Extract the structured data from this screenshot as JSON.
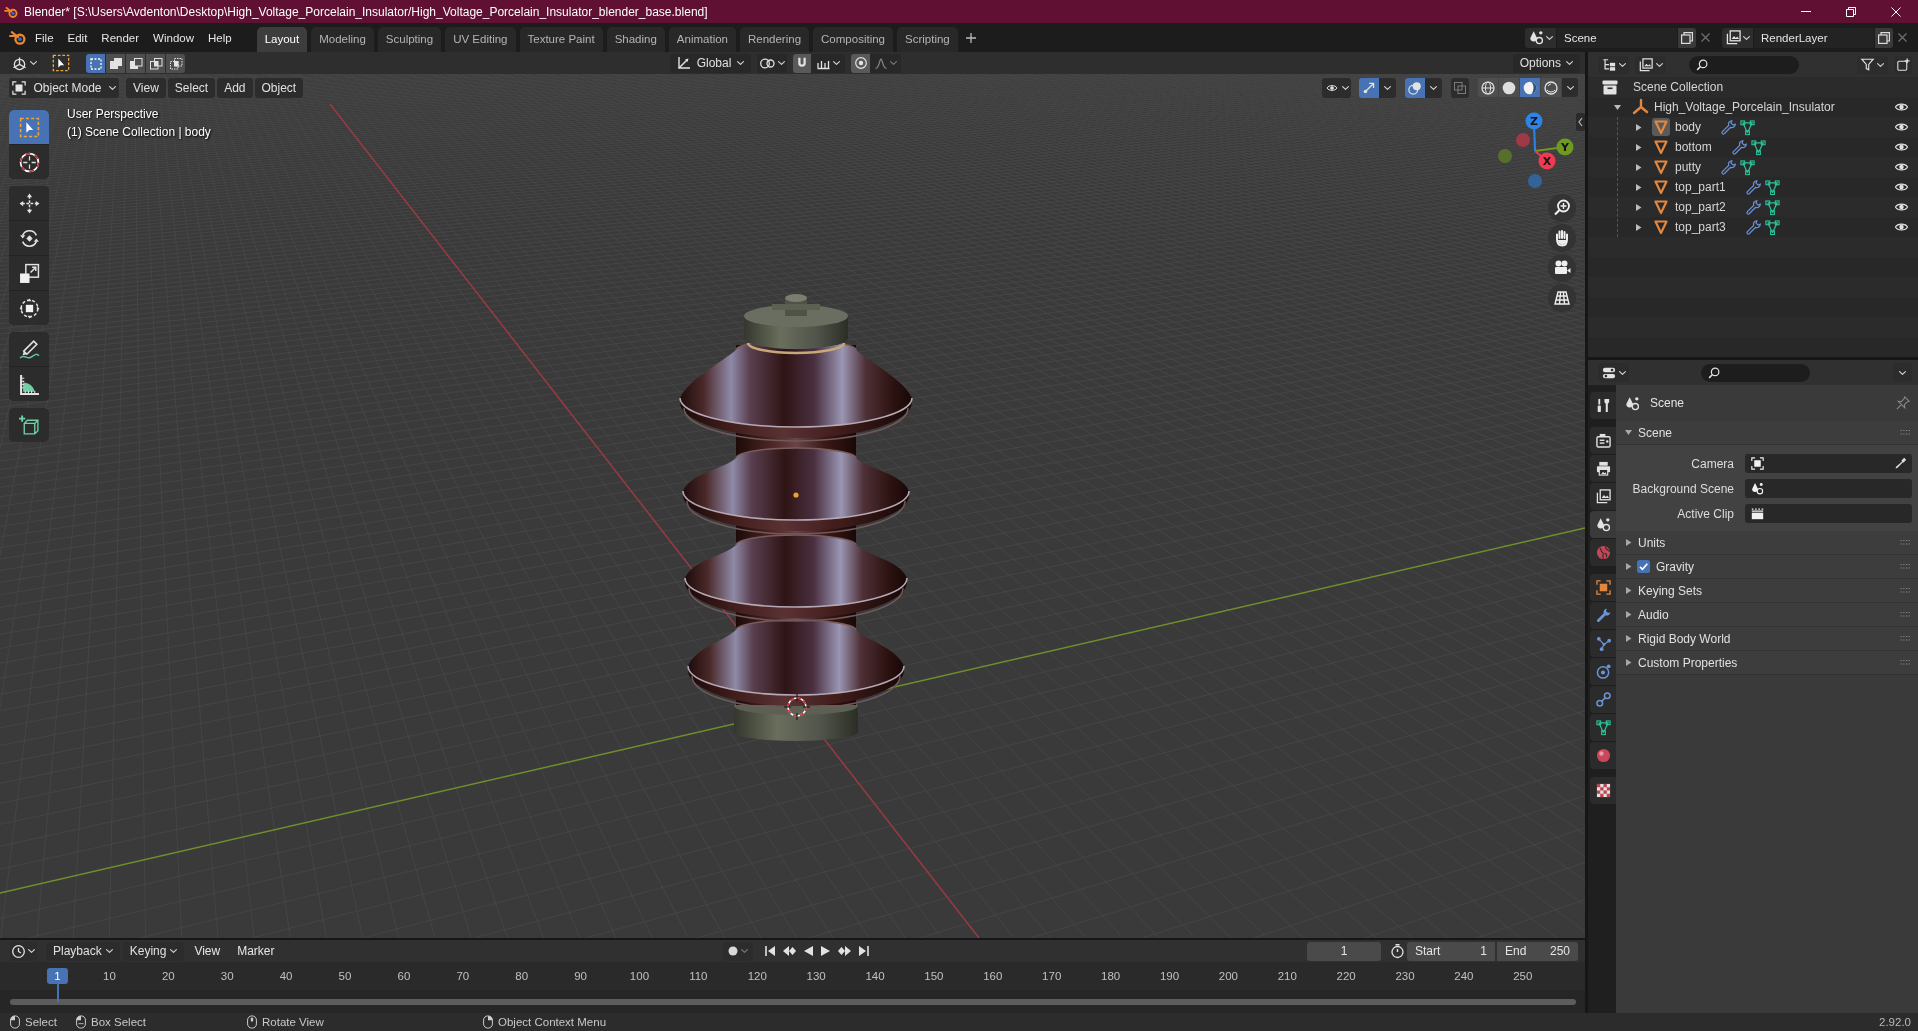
{
  "window": {
    "title": "Blender* [S:\\Users\\Avdenton\\Desktop\\High_Voltage_Porcelain_Insulator/High_Voltage_Porcelain_Insulator_blender_base.blend]"
  },
  "menu_bar": {
    "items": [
      "File",
      "Edit",
      "Render",
      "Window",
      "Help"
    ]
  },
  "workspace_tabs": [
    {
      "label": "Layout",
      "selected": true
    },
    {
      "label": "Modeling",
      "selected": false
    },
    {
      "label": "Sculpting",
      "selected": false
    },
    {
      "label": "UV Editing",
      "selected": false
    },
    {
      "label": "Texture Paint",
      "selected": false
    },
    {
      "label": "Shading",
      "selected": false
    },
    {
      "label": "Animation",
      "selected": false
    },
    {
      "label": "Rendering",
      "selected": false
    },
    {
      "label": "Compositing",
      "selected": false
    },
    {
      "label": "Scripting",
      "selected": false
    }
  ],
  "scene_selector": {
    "value": "Scene"
  },
  "view_layer_selector": {
    "value": "RenderLayer"
  },
  "tool_settings": {
    "select_modes": [
      {
        "kind": "set",
        "selected": true
      },
      {
        "kind": "extend",
        "selected": false
      },
      {
        "kind": "subtract",
        "selected": false
      },
      {
        "kind": "difference",
        "selected": false
      },
      {
        "kind": "intersect",
        "selected": false
      }
    ],
    "orientation": "Global",
    "options": "Options"
  },
  "viewport_header": {
    "mode": "Object Mode",
    "menus": [
      "View",
      "Select",
      "Add",
      "Object"
    ],
    "gizmos": true,
    "overlays": true,
    "xray": false,
    "shading_modes": [
      {
        "kind": "wireframe",
        "selected": false
      },
      {
        "kind": "solid",
        "selected": false
      },
      {
        "kind": "material",
        "selected": true
      },
      {
        "kind": "rendered",
        "selected": false
      }
    ]
  },
  "toolbar": {
    "groups": [
      {
        "tools": [
          {
            "kind": "select_box",
            "selected": true
          },
          {
            "kind": "cursor",
            "selected": false
          }
        ]
      },
      {
        "tools": [
          {
            "kind": "move",
            "selected": false
          },
          {
            "kind": "rotate",
            "selected": false
          },
          {
            "kind": "scale",
            "selected": false
          },
          {
            "kind": "transform",
            "selected": false
          }
        ]
      },
      {
        "tools": [
          {
            "kind": "annotate",
            "selected": false
          },
          {
            "kind": "measure",
            "selected": false
          }
        ]
      },
      {
        "tools": [
          {
            "kind": "add_cube",
            "selected": false
          }
        ]
      }
    ]
  },
  "viewport": {
    "view_name": "User Perspective",
    "context": "(1) Scene Collection | body",
    "gizmo_axes": [
      {
        "label": "Z",
        "color": "#2e84e6"
      },
      {
        "label": "Y",
        "color": "#6e9a22"
      },
      {
        "label": "X",
        "color": "#f03a52"
      }
    ]
  },
  "outliner": {
    "scene_collection": "Scene Collection",
    "items": [
      {
        "name": "High_Voltage_Porcelain_Insulator",
        "kind": "empty",
        "expanded": true,
        "selected": false,
        "visible": true,
        "children": [
          {
            "name": "body",
            "kind": "mesh",
            "expanded": false,
            "selected": true,
            "visible": true
          },
          {
            "name": "bottom",
            "kind": "mesh",
            "expanded": false,
            "selected": false,
            "visible": true
          },
          {
            "name": "putty",
            "kind": "mesh",
            "expanded": false,
            "selected": false,
            "visible": true
          },
          {
            "name": "top_part1",
            "kind": "mesh",
            "expanded": false,
            "selected": false,
            "visible": true
          },
          {
            "name": "top_part2",
            "kind": "mesh",
            "expanded": false,
            "selected": false,
            "visible": true
          },
          {
            "name": "top_part3",
            "kind": "mesh",
            "expanded": false,
            "selected": false,
            "visible": true
          }
        ]
      }
    ]
  },
  "properties": {
    "tab_groups": [
      {
        "tabs": [
          {
            "kind": "tool",
            "selected": false
          }
        ]
      },
      {
        "tabs": [
          {
            "kind": "render",
            "selected": false
          },
          {
            "kind": "output",
            "selected": false
          },
          {
            "kind": "view_layer",
            "selected": false
          },
          {
            "kind": "scene",
            "selected": true
          },
          {
            "kind": "world",
            "selected": false
          }
        ]
      },
      {
        "tabs": [
          {
            "kind": "object",
            "selected": false
          },
          {
            "kind": "modifiers",
            "selected": false
          },
          {
            "kind": "particles",
            "selected": false
          },
          {
            "kind": "physics",
            "selected": false
          },
          {
            "kind": "constraints",
            "selected": false
          },
          {
            "kind": "data",
            "selected": false
          },
          {
            "kind": "material",
            "selected": false
          }
        ]
      },
      {
        "tabs": [
          {
            "kind": "texture",
            "selected": false
          }
        ]
      }
    ],
    "context": "Scene",
    "panels": [
      {
        "label": "Scene",
        "kind": "plain",
        "expanded": true,
        "fields": [
          {
            "label": "Camera",
            "kind": "object"
          },
          {
            "label": "Background Scene",
            "kind": "scene"
          },
          {
            "label": "Active Clip",
            "kind": "clip"
          }
        ]
      },
      {
        "label": "Units",
        "kind": "plain",
        "expanded": false
      },
      {
        "label": "Gravity",
        "kind": "toggle",
        "checked": true,
        "expanded": false
      },
      {
        "label": "Keying Sets",
        "kind": "plain",
        "expanded": false
      },
      {
        "label": "Audio",
        "kind": "plain",
        "expanded": false
      },
      {
        "label": "Rigid Body World",
        "kind": "plain",
        "expanded": false
      },
      {
        "label": "Custom Properties",
        "kind": "plain",
        "expanded": false
      }
    ]
  },
  "timeline": {
    "menus": [
      {
        "label": "Playback",
        "kind": "dropdown"
      },
      {
        "label": "Keying",
        "kind": "dropdown"
      },
      {
        "label": "View",
        "kind": "menu"
      },
      {
        "label": "Marker",
        "kind": "menu"
      }
    ],
    "current_frame": "1",
    "start": {
      "label": "Start",
      "value": "1"
    },
    "end": {
      "label": "End",
      "value": "250"
    },
    "playhead": "1",
    "ruler": [
      "10",
      "20",
      "30",
      "40",
      "50",
      "60",
      "70",
      "80",
      "90",
      "100",
      "110",
      "120",
      "130",
      "140",
      "150",
      "160",
      "170",
      "180",
      "190",
      "200",
      "210",
      "220",
      "230",
      "240",
      "250"
    ]
  },
  "status_bar": {
    "hints": [
      {
        "kind": "left_click",
        "label": "Select"
      },
      {
        "kind": "left_drag",
        "label": "Box Select"
      },
      {
        "kind": "middle_drag",
        "label": "Rotate View"
      },
      {
        "kind": "right_click",
        "label": "Object Context Menu"
      }
    ],
    "version": "2.92.0"
  }
}
